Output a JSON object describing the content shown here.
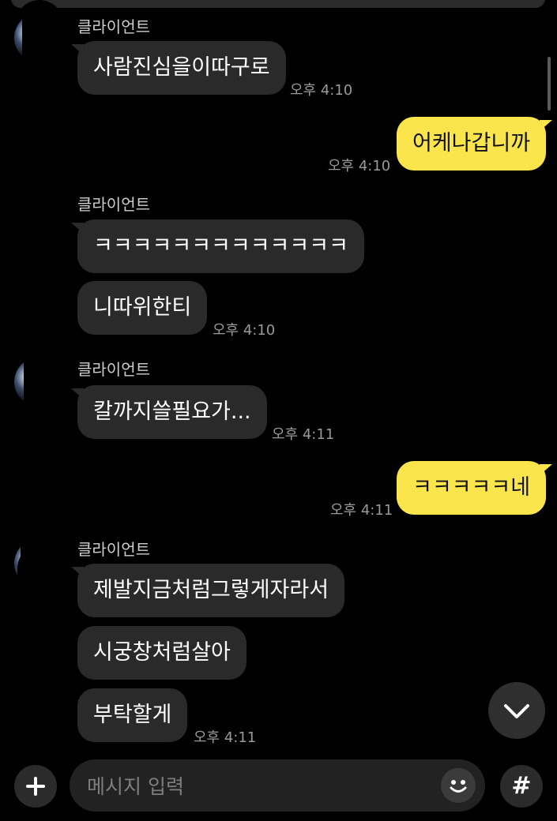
{
  "sender_name": "클라이언트",
  "messages": [
    {
      "text": "사람진심을이따구로",
      "time": "오후 4:10"
    },
    {
      "text": "어케나갑니까",
      "time": "오후 4:10"
    },
    {
      "text": "ㅋㅋㅋㅋㅋㅋㅋㅋㅋㅋㅋㅋㅋ"
    },
    {
      "text": "니따위한티",
      "time": "오후 4:10"
    },
    {
      "text": "칼까지쓸필요가...",
      "time": "오후 4:11"
    },
    {
      "text": "ㅋㅋㅋㅋㅋ네",
      "time": "오후 4:11"
    },
    {
      "text": "제발지금처럼그렇게자라서"
    },
    {
      "text": "시궁창처럼살아"
    },
    {
      "text": "부탁할게",
      "time": "오후 4:11"
    }
  ],
  "composer": {
    "placeholder": "메시지 입력",
    "hash_label": "#"
  },
  "colors": {
    "background": "#000000",
    "incoming_bubble": "#2a2a2a",
    "outgoing_bubble": "#fbe54d"
  }
}
